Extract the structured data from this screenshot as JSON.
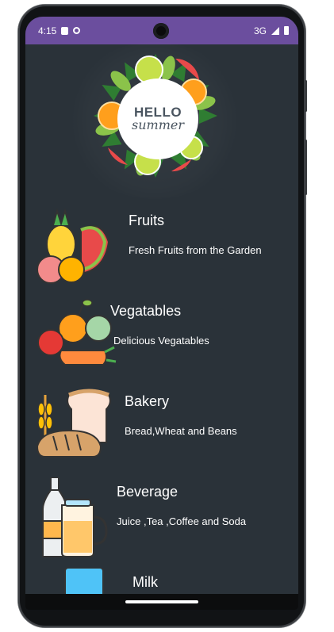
{
  "status_bar": {
    "time": "4:15",
    "network": "3G",
    "color": "#6b4e9e"
  },
  "hero": {
    "badge_line1": "HELLO",
    "badge_line2": "summer"
  },
  "categories": [
    {
      "title": "Fruits",
      "subtitle": "Fresh Fruits from the Garden",
      "icon": "fruits-illustration-icon"
    },
    {
      "title": "Vegatables",
      "subtitle": "Delicious Vegatables",
      "icon": "vegetables-illustration-icon"
    },
    {
      "title": "Bakery",
      "subtitle": "Bread,Wheat and Beans",
      "icon": "bakery-illustration-icon"
    },
    {
      "title": "Beverage",
      "subtitle": "Juice ,Tea ,Coffee and Soda",
      "icon": "beverage-illustration-icon"
    },
    {
      "title": "Milk",
      "subtitle": "",
      "icon": "milk-illustration-icon"
    }
  ],
  "colors": {
    "background": "#2a3239",
    "text": "#ffffff"
  }
}
